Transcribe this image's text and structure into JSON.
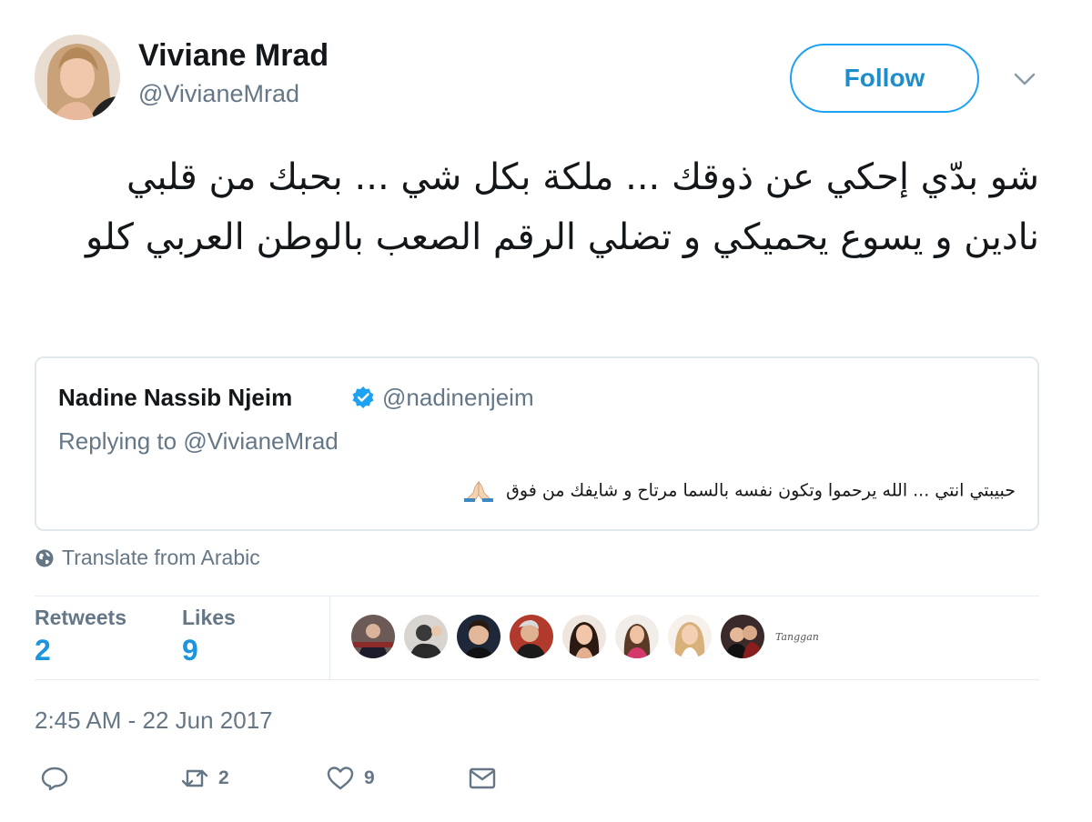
{
  "author": {
    "name": "Viviane Mrad",
    "handle": "@VivianeMrad",
    "follow_label": "Follow"
  },
  "tweet": {
    "text": "شو بدّي إحكي عن ذوقك ... ملكة بكل شي ... بحبك من قلبي نادين و يسوع يحميكي و تضلي الرقم الصعب بالوطن العربي كلو"
  },
  "quote": {
    "name": "Nadine Nassib Njeim",
    "handle": "@nadinenjeim",
    "replying_label": "Replying to",
    "replying_to": "@VivianeMrad",
    "text": "حبيبتي انتي ... الله يرحموا وتكون نفسه بالسما مرتاح و شايفك من فوق",
    "verified_color": "#1da1f2"
  },
  "translate_label": "Translate from Arabic",
  "stats": {
    "retweets_label": "Retweets",
    "retweets": "2",
    "likes_label": "Likes",
    "likes": "9",
    "likers_more": "Tanggan"
  },
  "timestamp": "2:45 AM - 22 Jun 2017",
  "actions": {
    "reply_icon": "reply-icon",
    "retweet_count": "2",
    "like_count": "9",
    "dm_icon": "envelope-icon"
  },
  "colors": {
    "accent": "#1da1f2",
    "link": "#1b95e0",
    "secondary_text": "#657786",
    "border": "#e1e8ed"
  }
}
